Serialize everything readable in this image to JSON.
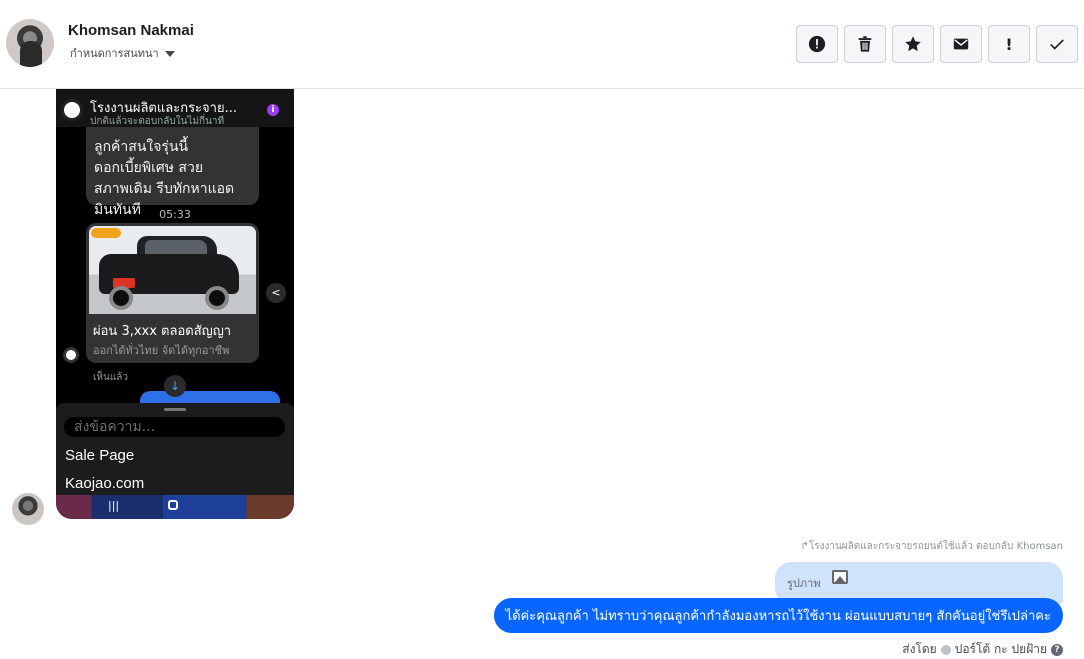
{
  "header": {
    "contact_name": "Khomsan Nakmai",
    "assign_label": "กำหนดการสนทนา",
    "toolbar": {
      "spam_icon": "alert-circle-icon",
      "delete_icon": "trash-icon",
      "star_icon": "star-icon",
      "mark_unread_icon": "envelope-icon",
      "follow_up_label": "!",
      "done_icon": "check-icon"
    }
  },
  "image_message": {
    "top_title": "โรงงานผลิตและกระจาย...",
    "top_subtitle": "ปกติแล้วจะตอบกลับในไม่กี่นาที",
    "bubble_text": "ลูกค้าสนใจรุ่นนี้\nดอกเบี้ยพิเศษ สวย\nสภาพเดิม รีบทักหาแอด\nมินทันที",
    "time": "05:33",
    "card_title": "ผ่อน 3,xxx ตลอดสัญญา",
    "card_subtitle": "ออกได้ทั่วไทย จัดได้ทุกอาชีพ",
    "seen": "เห็นแล้ว",
    "input_placeholder": "ส่งข้อความ...",
    "menu_items": [
      "Sale Page",
      "Kaojao.com"
    ]
  },
  "reply": {
    "note": "โรงงานผลิตและกระจายรถยนต์ใช้แล้ว ตอบกลับ Khomsan",
    "quoted_label": "รูปภาพ",
    "message": "ได้ค่ะคุณลูกค้า ไม่ทราบว่าคุณลูกค้ากำลังมองหารถไว้ใช้งาน ผ่อนแบบสบายๆ สักคันอยู่ใช่รึเปล่าคะ",
    "sent_by_label": "ส่งโดย",
    "sender": "ปอร์โต้ กะ ปยฝ้าย"
  },
  "colors": {
    "sent_bubble": "#0866ff",
    "reply_quote_bubble": "#cfe3fb",
    "border": "#dddfe2"
  }
}
